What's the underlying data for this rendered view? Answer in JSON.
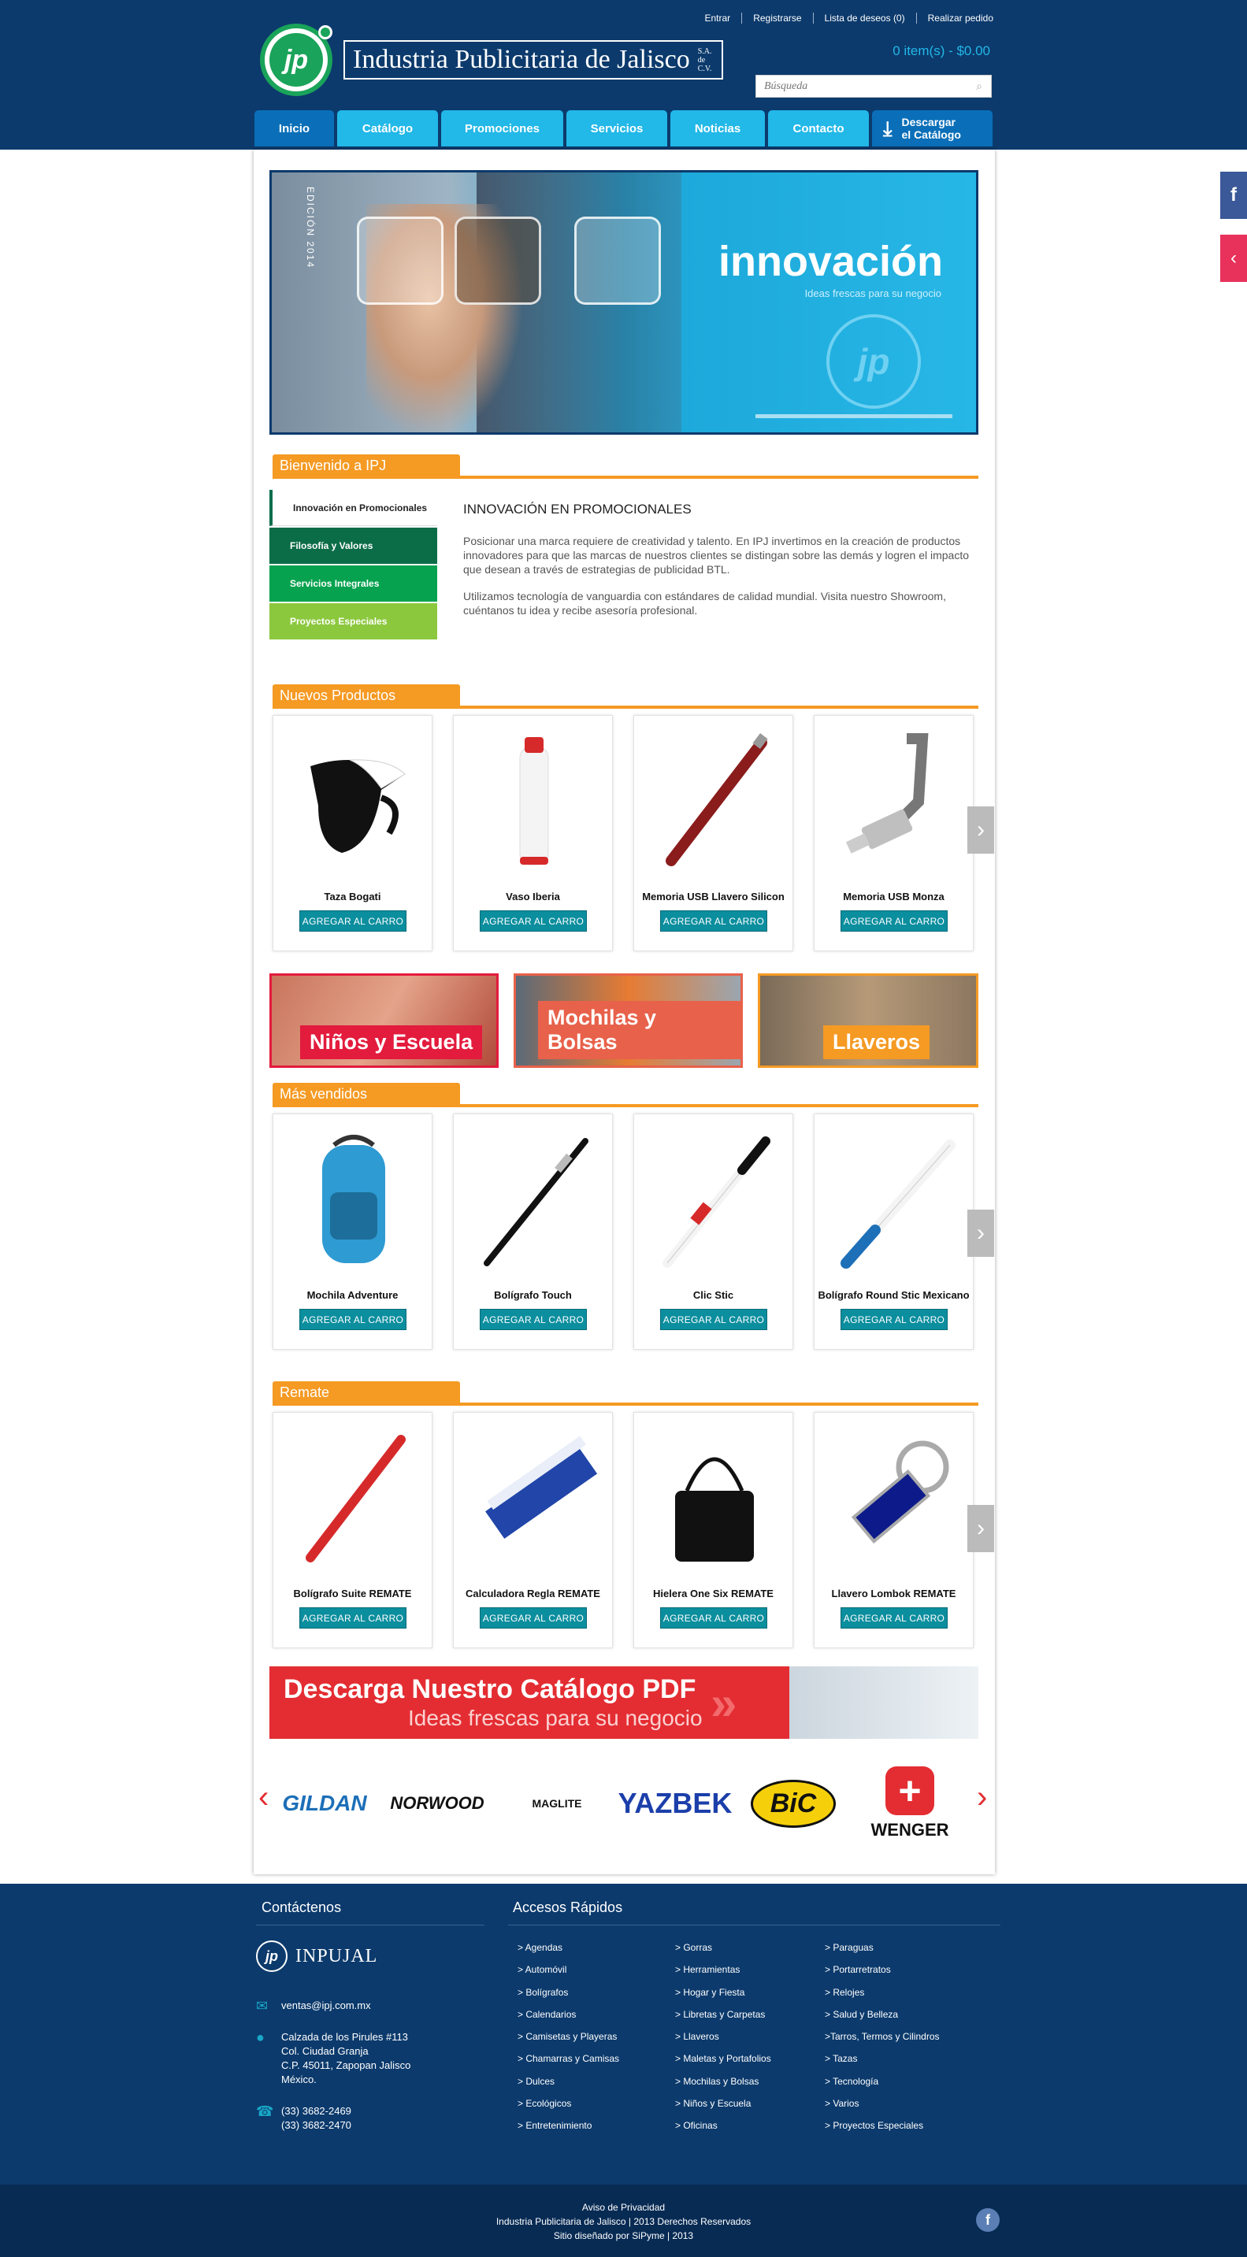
{
  "header": {
    "top_links": [
      "Entrar",
      "Registrarse",
      "Lista de deseos (0)",
      "Realizar pedido"
    ],
    "logo_text": "Industria Publicitaria de Jalisco",
    "logo_suffix": "S.A. de C.V.",
    "logo_initials": "jp",
    "cart_total": "0 item(s) - $0.00",
    "search_placeholder": "Búsqueda"
  },
  "nav": {
    "tabs": [
      "Inicio",
      "Catálogo",
      "Promociones",
      "Servicios",
      "Noticias",
      "Contacto"
    ],
    "download": "Descargar el Catálogo"
  },
  "banner": {
    "edition": "EDICIÓN 2014",
    "title": "innovación",
    "subtitle": "Ideas frescas para su negocio"
  },
  "welcome": {
    "heading": "Bienvenido a IPJ",
    "tabs": [
      "Innovación en Promocionales",
      "Filosofía y Valores",
      "Servicios Integrales",
      "Proyectos Especiales"
    ],
    "title": "INNOVACIÓN EN PROMOCIONALES",
    "p1": "Posicionar una marca requiere de creatividad y talento. En IPJ invertimos en la creación de productos innovadores para que las marcas de nuestros clientes se distingan sobre las demás y logren el impacto que desean a través de estrategias de publicidad BTL.",
    "p2": "Utilizamos tecnología de vanguardia con estándares de calidad mundial. Visita nuestro Showroom, cuéntanos tu idea y recibe asesoría profesional."
  },
  "add_label": "AGREGAR AL CARRO",
  "sections": {
    "new": {
      "heading": "Nuevos Productos",
      "products": [
        "Taza Bogati",
        "Vaso Iberia",
        "Memoria USB Llavero Silicon",
        "Memoria USB Monza"
      ]
    },
    "best": {
      "heading": "Más vendidos",
      "products": [
        "Mochila Adventure",
        "Bolígrafo Touch",
        "Clic Stic",
        "Bolígrafo Round Stic Mexicano"
      ]
    },
    "sale": {
      "heading": "Remate",
      "products": [
        "Bolígrafo Suite REMATE",
        "Calculadora Regla REMATE",
        "Hielera One Six REMATE",
        "Llavero Lombok REMATE"
      ]
    }
  },
  "category_banners": [
    "Niños y Escuela",
    "Mochilas y Bolsas",
    "Llaveros"
  ],
  "pdf_banner": {
    "title": "Descarga Nuestro Catálogo PDF",
    "subtitle": "Ideas frescas para su negocio"
  },
  "brands": [
    "GILDAN",
    "NORWOOD",
    "MAGLITE",
    "YAZBEK",
    "BiC",
    "WENGER"
  ],
  "footer": {
    "contact_title": "Contáctenos",
    "quick_title": "Accesos Rápidos",
    "brand": "INPUJAL",
    "email": "ventas@ipj.com.mx",
    "address": [
      "Calzada de los Pirules #113",
      "Col. Ciudad Granja",
      "C.P. 45011, Zapopan Jalisco",
      "México."
    ],
    "phones": [
      "(33) 3682-2469",
      "(33) 3682-2470"
    ],
    "links_col1": [
      "> Agendas",
      "> Automóvil",
      "> Bolígrafos",
      "> Calendarios",
      "> Camisetas y Playeras",
      "> Chamarras y Camisas",
      "> Dulces",
      "> Ecológicos",
      "> Entretenimiento"
    ],
    "links_col2": [
      "> Gorras",
      "> Herramientas",
      "> Hogar y Fiesta",
      "> Libretas y Carpetas",
      "> Llaveros",
      "> Maletas y Portafolios",
      "> Mochilas y Bolsas",
      "> Niños y Escuela",
      "> Oficinas"
    ],
    "links_col3": [
      "> Paraguas",
      "> Portarretratos",
      "> Relojes",
      "> Salud y Belleza",
      ">Tarros, Termos y Cilindros",
      "> Tazas",
      "> Tecnología",
      "> Varios",
      "> Proyectos Especiales"
    ],
    "bottom": [
      "Aviso de Privacidad",
      "Industria Publicitaria de Jalisco | 2013 Derechos Reservados",
      "Sitio diseñado por SiPyme | 2013"
    ]
  },
  "colors": {
    "navy": "#0c3a6c",
    "cyan": "#22b8e8",
    "orange": "#f59a23",
    "teal_button": "#0b8e9e",
    "red": "#e32d32"
  }
}
